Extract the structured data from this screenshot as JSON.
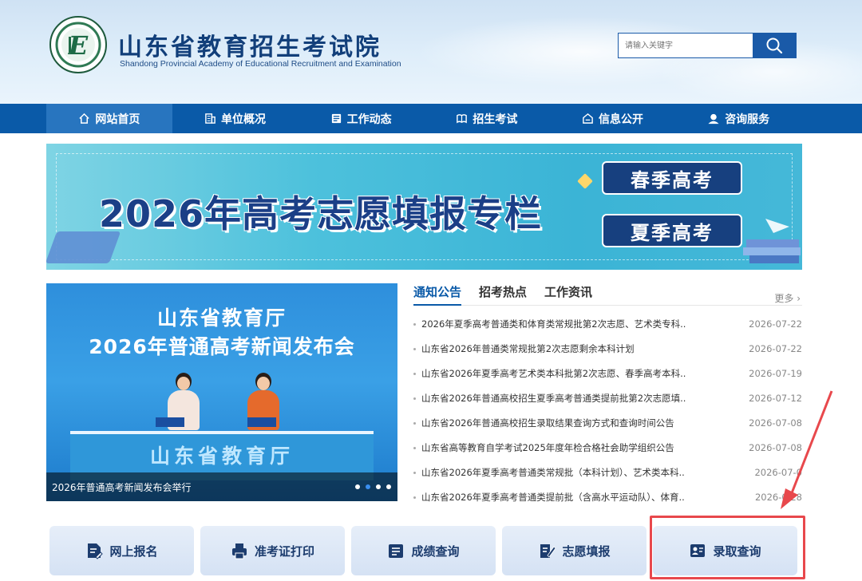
{
  "header": {
    "title": "山东省教育招生考试院",
    "subtitle": "Shandong Provincial Academy of Educational Recruitment and Examination"
  },
  "search": {
    "placeholder": "请输入关键字",
    "icon": "search-icon"
  },
  "nav": {
    "items": [
      {
        "label": "网站首页",
        "icon": "home-icon",
        "active": true
      },
      {
        "label": "单位概况",
        "icon": "building-icon"
      },
      {
        "label": "工作动态",
        "icon": "news-icon"
      },
      {
        "label": "招生考试",
        "icon": "book-icon"
      },
      {
        "label": "信息公开",
        "icon": "info-icon"
      },
      {
        "label": "咨询服务",
        "icon": "user-service-icon"
      }
    ]
  },
  "banner": {
    "title": "2026年高考志愿填报专栏",
    "buttons": [
      "春季高考",
      "夏季高考"
    ]
  },
  "carousel": {
    "headline1": "山东省教育厅",
    "headline2": "2026年普通高考新闻发布会",
    "desk_text": "山东省教育厅",
    "caption": "2026年普通高考新闻发布会举行",
    "slide_count": 4,
    "active_slide": 2
  },
  "news": {
    "tabs": [
      "通知公告",
      "招考热点",
      "工作资讯"
    ],
    "active_tab": 0,
    "more": "更多",
    "items": [
      {
        "title": "2026年夏季高考普通类和体育类常规批第2次志愿、艺术类专科..",
        "date": "2026-07-22"
      },
      {
        "title": "山东省2026年普通类常规批第2次志愿剩余本科计划",
        "date": "2026-07-22"
      },
      {
        "title": "山东省2026年夏季高考艺术类本科批第2次志愿、春季高考本科..",
        "date": "2026-07-19"
      },
      {
        "title": "山东省2026年普通高校招生夏季高考普通类提前批第2次志愿填..",
        "date": "2026-07-12"
      },
      {
        "title": "山东省2026年普通高校招生录取结果查询方式和查询时间公告",
        "date": "2026-07-08"
      },
      {
        "title": "山东省高等教育自学考试2025年度年检合格社会助学组织公告",
        "date": "2026-07-08"
      },
      {
        "title": "山东省2026年夏季高考普通类常规批（本科计划）、艺术类本科..",
        "date": "2026-07-0"
      },
      {
        "title": "山东省2026年夏季高考普通类提前批（含高水平运动队）、体育..",
        "date": "2026-0  28"
      }
    ]
  },
  "quick_links": [
    {
      "label": "网上报名",
      "icon": "document-edit-icon"
    },
    {
      "label": "准考证打印",
      "icon": "printer-icon"
    },
    {
      "label": "成绩查询",
      "icon": "score-list-icon"
    },
    {
      "label": "志愿填报",
      "icon": "form-pen-icon"
    },
    {
      "label": "录取查询",
      "icon": "admission-card-icon"
    }
  ],
  "colors": {
    "primary": "#0a5aa8",
    "title": "#123f7a",
    "highlight": "#e8484c"
  }
}
